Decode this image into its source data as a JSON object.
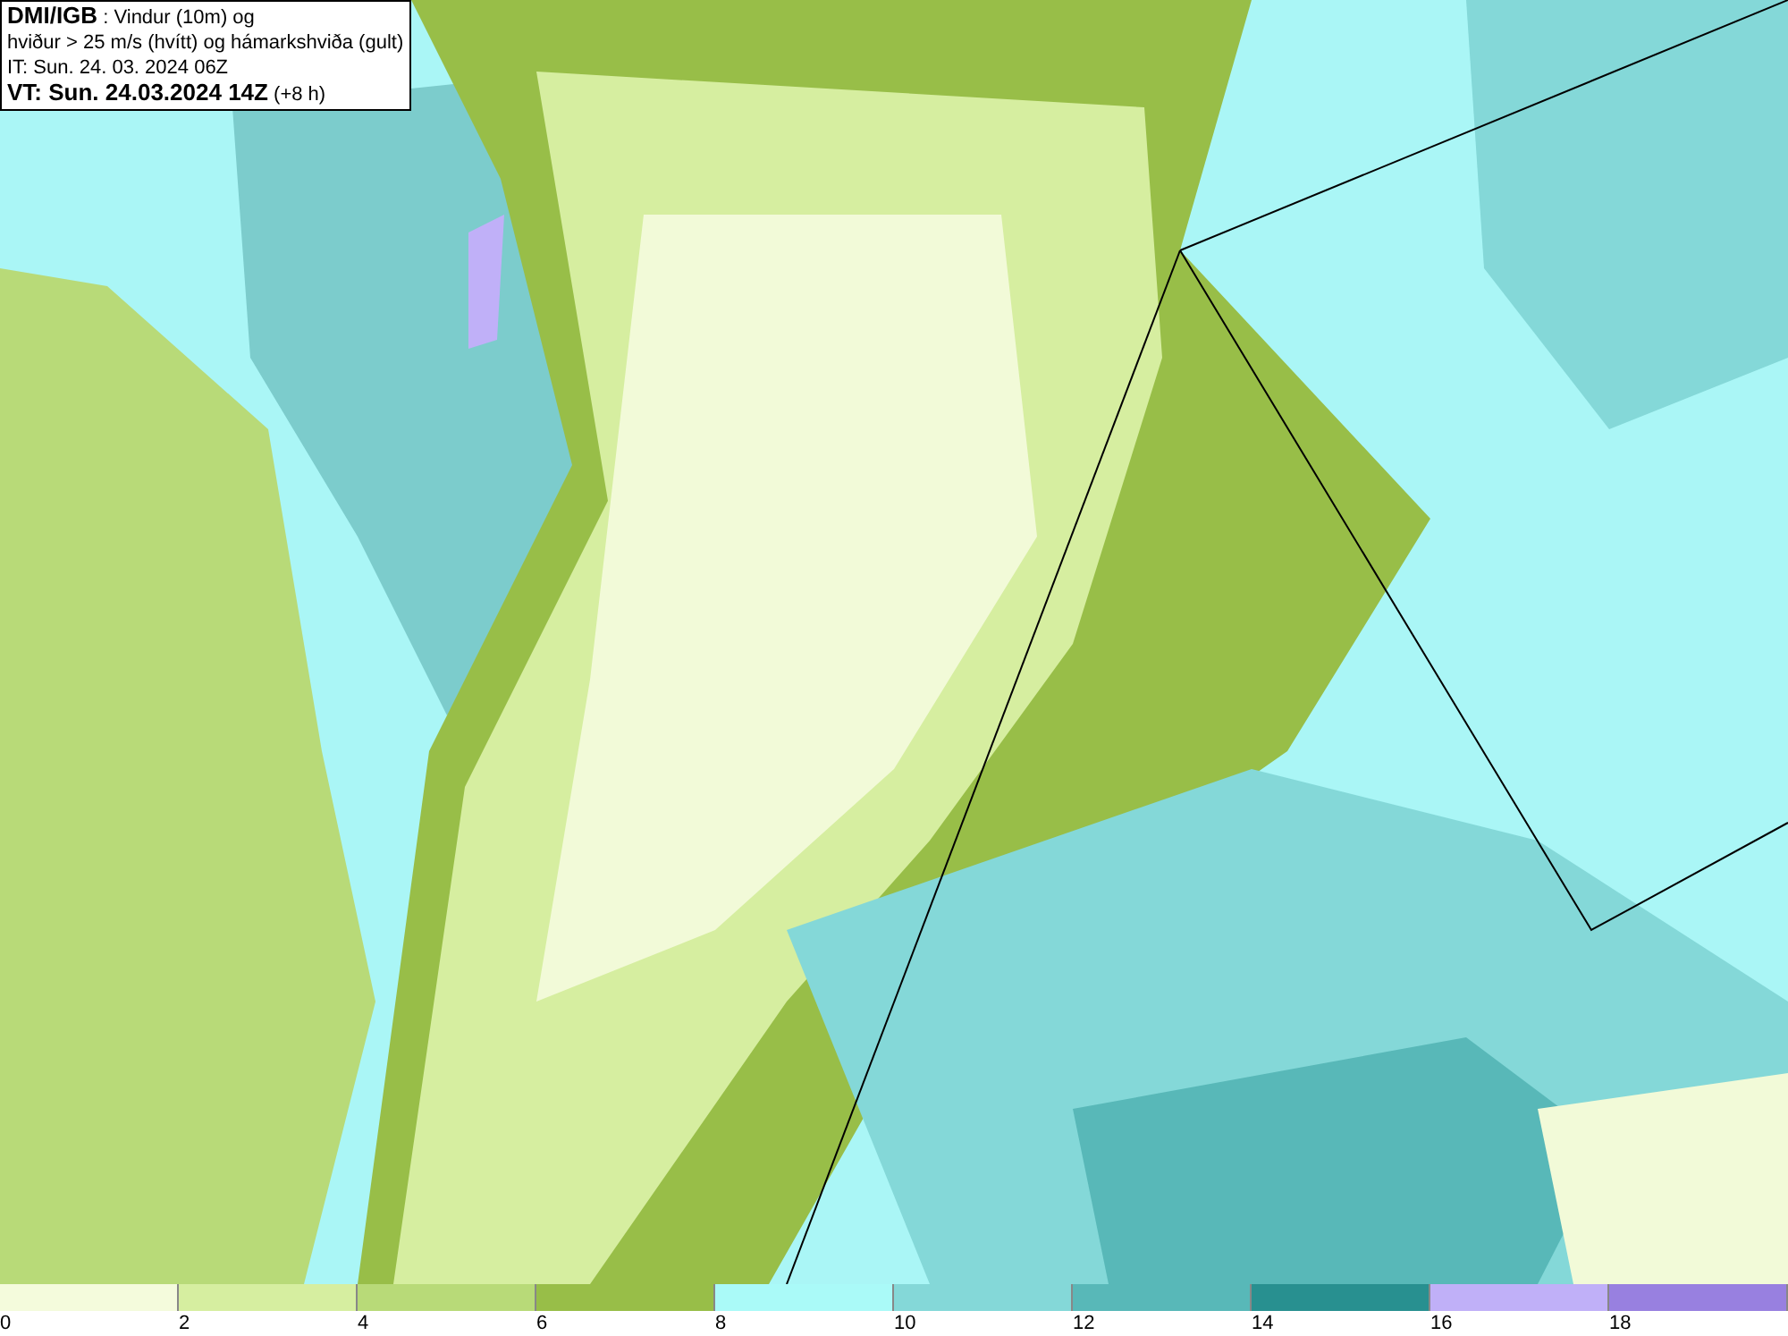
{
  "header": {
    "lines": [
      "**DMI/IGB** : Vindur (10m) og",
      "hviður > 25 m/s (hvítt) og hámarkshviða (gult)",
      "IT: Sun. 24. 03. 2024 06Z",
      "**VT: Sun. 24.03.2024 14Z** (+8 h)"
    ]
  },
  "legend": [
    {
      "label": "0",
      "color": "#f4fbdc"
    },
    {
      "label": "2",
      "color": "#d6eea0"
    },
    {
      "label": "4",
      "color": "#b8da78"
    },
    {
      "label": "6",
      "color": "#98be48"
    },
    {
      "label": "8",
      "color": "#aafaf8"
    },
    {
      "label": "10",
      "color": "#84d8d8"
    },
    {
      "label": "12",
      "color": "#58b8b8"
    },
    {
      "label": "14",
      "color": "#289090"
    },
    {
      "label": "16",
      "color": "#c0b0f8"
    },
    {
      "label": "18",
      "color": "#9880e0"
    }
  ]
}
